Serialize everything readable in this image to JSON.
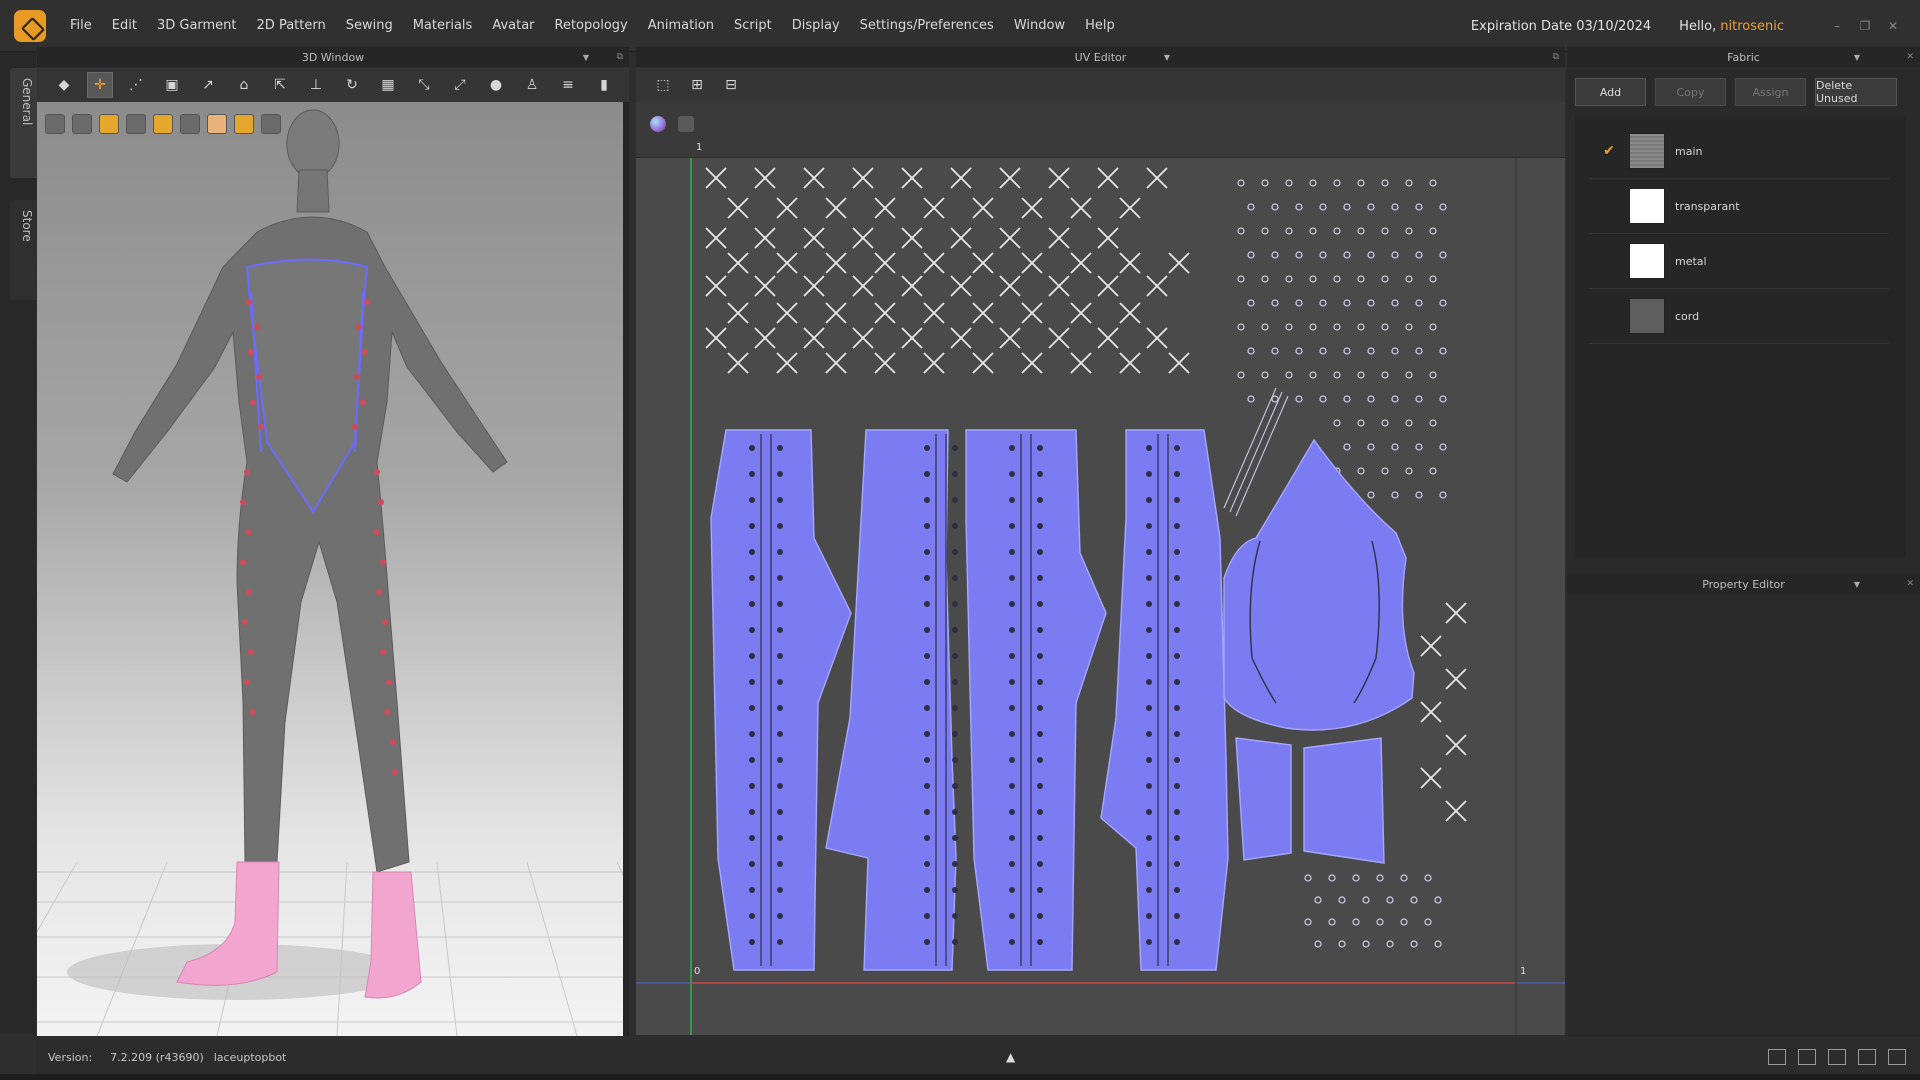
{
  "menu": {
    "items": [
      "File",
      "Edit",
      "3D Garment",
      "2D Pattern",
      "Sewing",
      "Materials",
      "Avatar",
      "Retopology",
      "Animation",
      "Script",
      "Display",
      "Settings/Preferences",
      "Window",
      "Help"
    ],
    "expiration": "Expiration Date 03/10/2024",
    "hello": "Hello,",
    "username": "nitrosenic"
  },
  "side_tabs": {
    "general": "General",
    "store": "Store"
  },
  "window3d": {
    "title": "3D Window"
  },
  "uv_editor": {
    "title": "UV Editor",
    "tick_top": "1",
    "tick_origin": "0",
    "tick_right": "1"
  },
  "fabric": {
    "title": "Fabric",
    "buttons": {
      "add": "Add",
      "copy": "Copy",
      "assign": "Assign",
      "delete_unused": "Delete Unused"
    },
    "items": [
      {
        "name": "main",
        "checked": true,
        "swatch": "#8a8a8a"
      },
      {
        "name": "transparant",
        "checked": false,
        "swatch": "#ffffff"
      },
      {
        "name": "metal",
        "checked": false,
        "swatch": "#ffffff"
      },
      {
        "name": "cord",
        "checked": false,
        "swatch": "#5e5e5e"
      }
    ]
  },
  "property_editor": {
    "title": "Property Editor"
  },
  "status": {
    "version_label": "Version:",
    "version": "7.2.209 (r43690)",
    "project": "laceuptopbot"
  },
  "colors": {
    "accent": "#f0a033",
    "uv_piece": "#7b7bf2",
    "uv_bg": "#4a4a4a",
    "boots": "#f2a6cf"
  }
}
